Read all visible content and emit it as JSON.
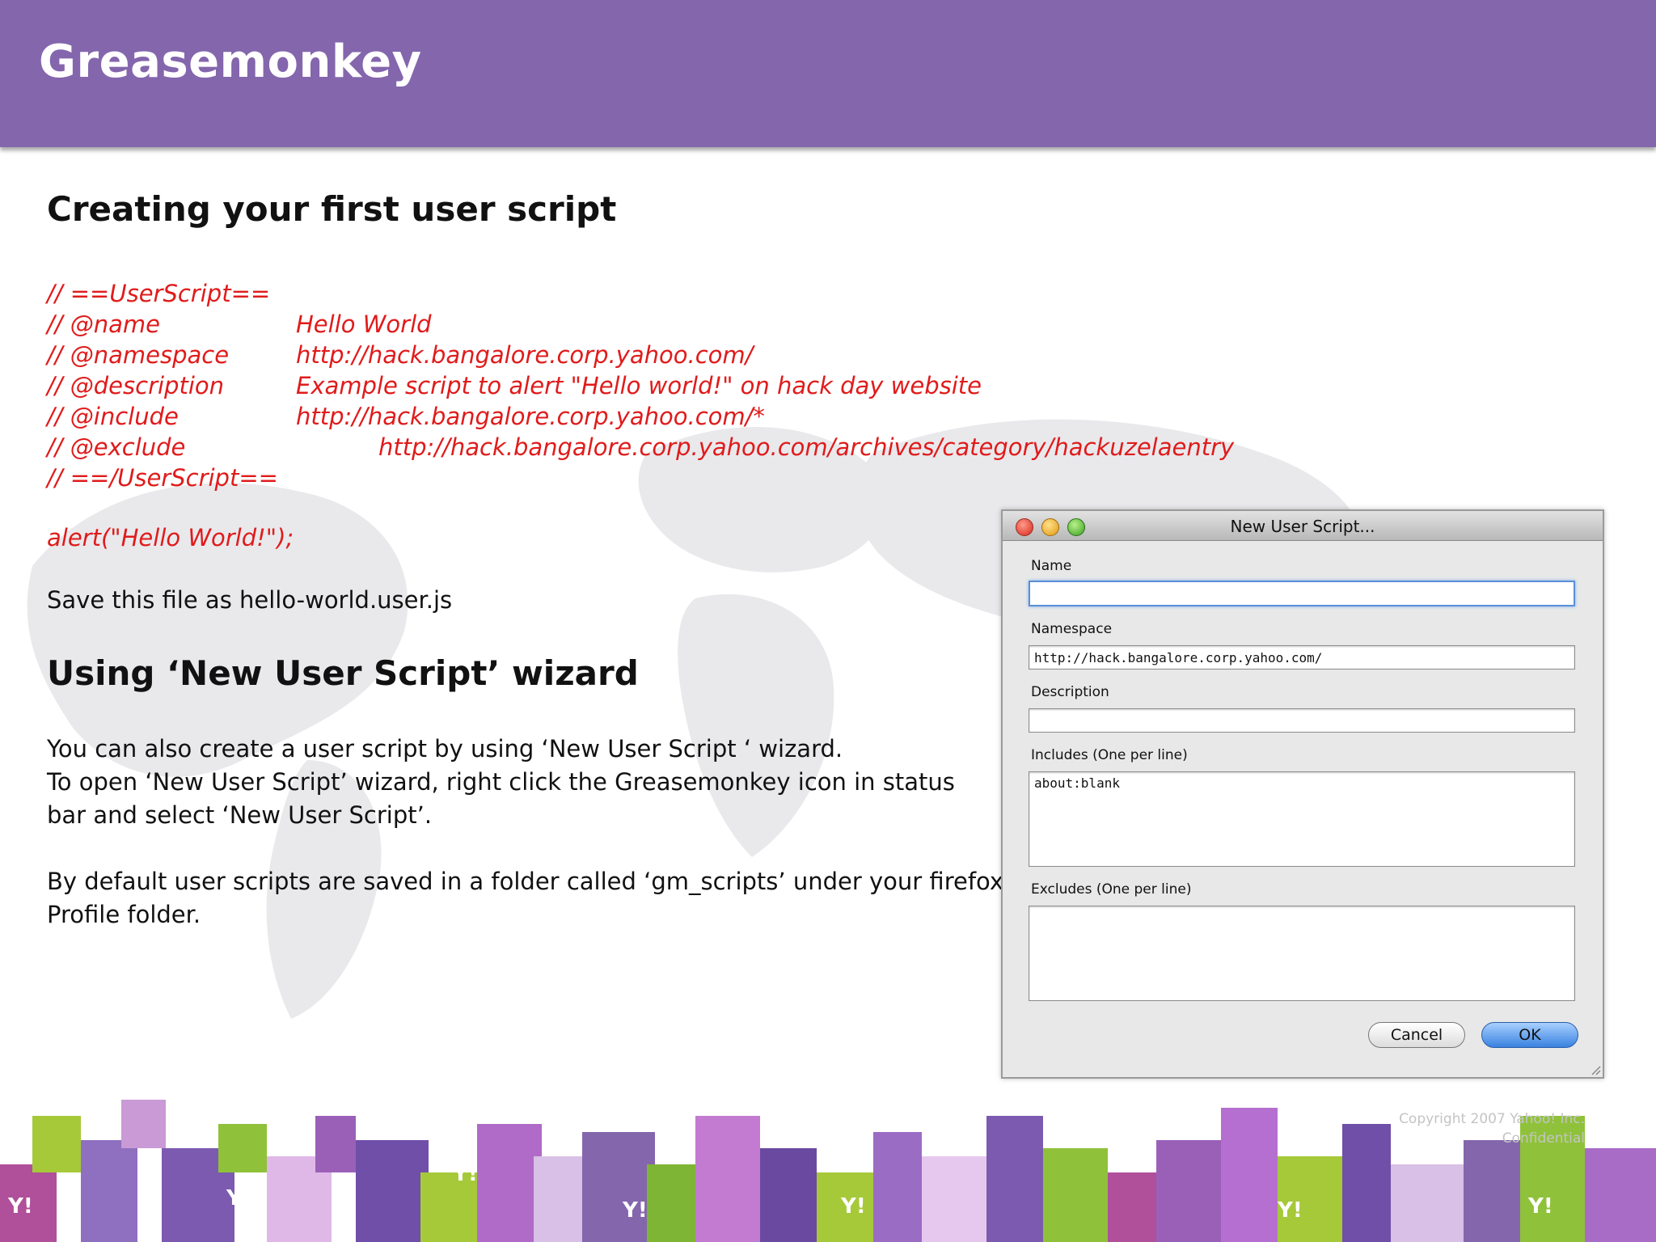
{
  "slide": {
    "title": "Greasemonkey",
    "section1_heading": "Creating your first user script",
    "code": {
      "l0": "// ==UserScript==",
      "name_key": "// @name",
      "name_val": "Hello World",
      "ns_key": "// @namespace",
      "ns_val": "http://hack.bangalore.corp.yahoo.com/",
      "desc_key": "// @description",
      "desc_val": "Example script to alert \"Hello world!\" on hack day website",
      "inc_key": "// @include",
      "inc_val": "http://hack.bangalore.corp.yahoo.com/*",
      "exc_key": "// @exclude",
      "exc_val": "http://hack.bangalore.corp.yahoo.com/archives/category/hackuzelaentry",
      "l_end": "// ==/UserScript==",
      "alert": "alert(\"Hello World!\");"
    },
    "save_note": "Save this file as hello-world.user.js",
    "section2_heading": "Using ‘New User Script’ wizard",
    "para1": "You can also create a user script by using ‘New User Script ‘ wizard.",
    "para2a": "To open ‘New User Script’ wizard, right click the Greasemonkey icon in status",
    "para2b": "bar and select ‘New User Script’.",
    "para3a": "By default user scripts are saved in a folder called ‘gm_scripts’ under your firefox",
    "para3b": "Profile folder.",
    "copyright_line1": "Copyright 2007 Yahoo! Inc.",
    "copyright_line2": "Confidential"
  },
  "dialog": {
    "title": "New User Script...",
    "name_label": "Name",
    "name_value": "",
    "namespace_label": "Namespace",
    "namespace_value": "http://hack.bangalore.corp.yahoo.com/",
    "description_label": "Description",
    "description_value": "",
    "includes_label": "Includes (One per line)",
    "includes_value": "about:blank",
    "excludes_label": "Excludes (One per line)",
    "excludes_value": "",
    "cancel_label": "Cancel",
    "ok_label": "OK"
  },
  "colors": {
    "header": "#8466ad",
    "code_red": "#e01b1b",
    "ok_blue": "#3a82e0"
  }
}
